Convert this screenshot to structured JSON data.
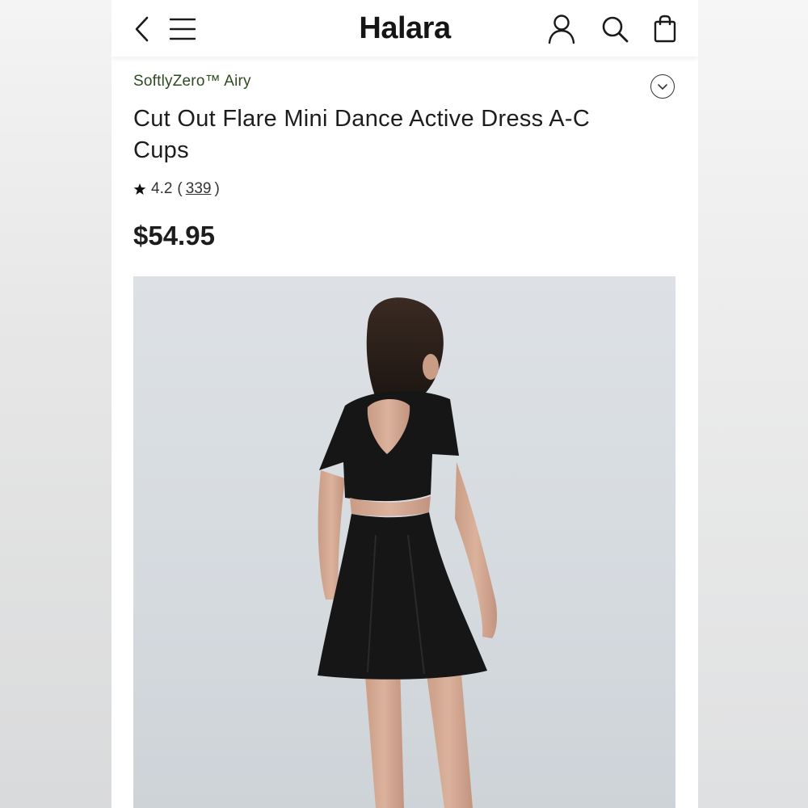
{
  "header": {
    "logo": "Halara",
    "icons": {
      "back": "chevron-left-icon",
      "menu": "hamburger-menu-icon",
      "account": "user-icon",
      "search": "search-icon",
      "cart": "shopping-bag-icon"
    }
  },
  "product": {
    "collection": "SoftlyZero™ Airy",
    "title": "Cut Out Flare Mini Dance Active Dress A-C Cups",
    "rating": "4.2",
    "rating_open": "(",
    "review_count": "339",
    "rating_close": ")",
    "price": "$54.95",
    "image_alt": "Model wearing black cut out flare mini dress, back view"
  },
  "colors": {
    "accent_green": "#2f4a22",
    "text": "#1d1d1d",
    "dress": "#161616"
  }
}
